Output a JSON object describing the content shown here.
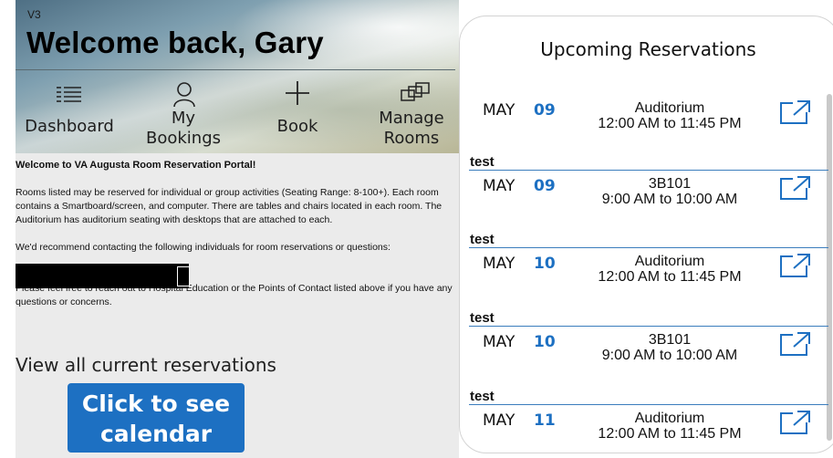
{
  "header": {
    "version": "V3",
    "welcome": "Welcome back, Gary"
  },
  "nav": [
    {
      "label": "Dashboard",
      "icon": "dashboard-icon"
    },
    {
      "label": "My Bookings",
      "icon": "person-icon"
    },
    {
      "label": "Book",
      "icon": "plus-icon"
    },
    {
      "label": "Manage Rooms",
      "icon": "rooms-icon"
    }
  ],
  "intro": {
    "title": "Welcome to VA Augusta Room Reservation Portal!",
    "p1": "Rooms listed may be reserved for individual or group activities (Seating Range: 8-100+). Each room contains a Smartboard/screen, and computer. There are tables and chairs located in each room. The Auditorium has auditorium seating with desktops that are attached to each.",
    "p2": "We'd recommend contacting the following individuals for room reservations or questions:",
    "p3": "Please feel free to reach out to Hospital Education or the Points of Contact listed above if you have any questions or concerns."
  },
  "view_all": "View all current reservations",
  "calendar_button": {
    "line1": "Click to see",
    "line2": "calendar"
  },
  "reservations": {
    "title": "Upcoming Reservations",
    "items": [
      {
        "note": "",
        "month": "MAY",
        "day": "09",
        "room": "Auditorium",
        "time": "12:00 AM to 11:45 PM"
      },
      {
        "note": "test",
        "month": "MAY",
        "day": "09",
        "room": "3B101",
        "time": "9:00 AM to 10:00 AM"
      },
      {
        "note": "test",
        "month": "MAY",
        "day": "10",
        "room": "Auditorium",
        "time": "12:00 AM to 11:45 PM"
      },
      {
        "note": "test",
        "month": "MAY",
        "day": "10",
        "room": "3B101",
        "time": "9:00 AM to 10:00 AM"
      },
      {
        "note": "test",
        "month": "MAY",
        "day": "11",
        "room": "Auditorium",
        "time": "12:00 AM to 11:45 PM"
      }
    ]
  },
  "colors": {
    "accent": "#1d70c2",
    "pane_bg": "#ebebeb"
  }
}
